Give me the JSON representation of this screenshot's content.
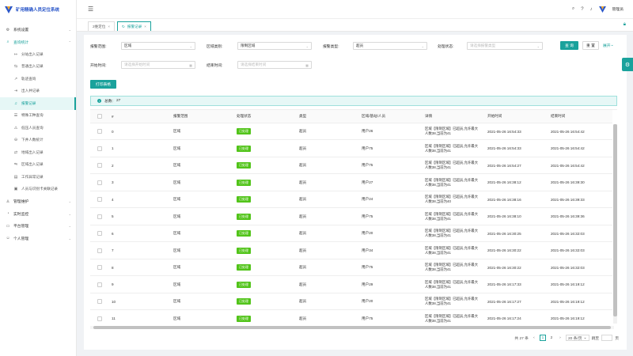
{
  "app": {
    "title": "矿用精确人员定位系统"
  },
  "colors": {
    "accent": "#1aa29c",
    "status_green": "#52c41a",
    "logo_blue": "#2b57c9"
  },
  "sidebar": {
    "items": [
      {
        "label": "系统设置",
        "icon": "gear-icon"
      },
      {
        "label": "查询统计",
        "icon": "search-icon"
      }
    ],
    "sub_items": [
      {
        "label": "分站出入记录",
        "icon": "exit-icon"
      },
      {
        "label": "普通出入记录",
        "icon": "link-icon"
      },
      {
        "label": "轨迹查询",
        "icon": "trend-icon"
      },
      {
        "label": "出入井记录",
        "icon": "enter-icon"
      },
      {
        "label": "报警记录",
        "icon": "bell-icon"
      },
      {
        "label": "特殊工种查询",
        "icon": "worker-icon"
      },
      {
        "label": "低压人员查询",
        "icon": "warning-icon"
      },
      {
        "label": "下井人数统计",
        "icon": "down-icon"
      },
      {
        "label": "地域出入记录",
        "icon": "map-icon"
      },
      {
        "label": "区域出入记录",
        "icon": "area-icon"
      },
      {
        "label": "工作异常记录",
        "icon": "doc-icon"
      },
      {
        "label": "人员与识别卡关联记录",
        "icon": "card-icon"
      }
    ],
    "bottom_items": [
      {
        "label": "管理维护",
        "icon": "user-icon"
      },
      {
        "label": "实时监控",
        "icon": "monitor-icon"
      },
      {
        "label": "平台管理",
        "icon": "desktop-icon"
      },
      {
        "label": "个人管理",
        "icon": "person-icon"
      }
    ]
  },
  "header": {
    "user_label": "管理员"
  },
  "tabs": [
    {
      "label": "2维定位"
    },
    {
      "label": "报警记录"
    }
  ],
  "filters": {
    "alarm_range_label": "报警范围:",
    "alarm_range_value": "区域",
    "area_category_label": "区域类别:",
    "area_category_value": "限制区域",
    "alarm_type_label": "报警类型:",
    "alarm_type_value": "超员",
    "status_label": "处理状态:",
    "status_placeholder": "请选择报警类型",
    "start_label": "开始时间:",
    "start_placeholder": "请选择开始时间",
    "end_label": "结束时间:",
    "end_placeholder": "请选择结束时间",
    "query_button": "查 询",
    "reset_button": "重 置",
    "expand_label": "展开"
  },
  "print_button": "打印表格",
  "summary": {
    "label": "总数:",
    "count": "27"
  },
  "table": {
    "headers": [
      "#",
      "报警范围",
      "处理状态",
      "类型",
      "区域/基站/人员",
      "详情",
      "开始时间",
      "结束时间"
    ],
    "rows": [
      {
        "idx": "0",
        "range": "区域",
        "status": "已处理",
        "type": "超员",
        "who": "用户26",
        "detail": "区域【限制区域】已超员,允许最大人数38,当前为41",
        "start": "2021-05-26 16:54:33",
        "end": "2021-05-26 16:54:42"
      },
      {
        "idx": "1",
        "range": "区域",
        "status": "已处理",
        "type": "超员",
        "who": "用户75",
        "detail": "区域【限制区域】已超员,允许最大人数38,当前为41",
        "start": "2021-05-26 16:54:33",
        "end": "2021-05-26 16:54:42"
      },
      {
        "idx": "2",
        "range": "区域",
        "status": "已处理",
        "type": "超员",
        "who": "用户75",
        "detail": "区域【限制区域】已超员,允许最大人数38,当前为41",
        "start": "2021-05-26 16:54:27",
        "end": "2021-05-26 16:54:42"
      },
      {
        "idx": "3",
        "range": "区域",
        "status": "已处理",
        "type": "超员",
        "who": "用户27",
        "detail": "区域【限制区域】已超员,允许最大人数38,当前为41",
        "start": "2021-05-26 16:38:12",
        "end": "2021-05-26 16:39:30"
      },
      {
        "idx": "4",
        "range": "区域",
        "status": "已处理",
        "type": "超员",
        "who": "用户24",
        "detail": "区域【限制区域】已超员,允许最大人数38,当前为40",
        "start": "2021-05-26 16:38:16",
        "end": "2021-05-26 16:39:33"
      },
      {
        "idx": "5",
        "range": "区域",
        "status": "已处理",
        "type": "超员",
        "who": "用户75",
        "detail": "区域【限制区域】已超员,允许最大人数38,当前为41",
        "start": "2021-05-26 16:38:10",
        "end": "2021-05-26 16:39:36"
      },
      {
        "idx": "6",
        "range": "区域",
        "status": "已处理",
        "type": "超员",
        "who": "用户20",
        "detail": "区域【限制区域】已超员,允许最大人数38,当前为41",
        "start": "2021-05-26 16:30:25",
        "end": "2021-05-26 16:32:03"
      },
      {
        "idx": "7",
        "range": "区域",
        "status": "已处理",
        "type": "超员",
        "who": "用户34",
        "detail": "区域【限制区域】已超员,允许最大人数38,当前为41",
        "start": "2021-05-26 16:30:22",
        "end": "2021-05-26 16:32:03"
      },
      {
        "idx": "8",
        "range": "区域",
        "status": "已处理",
        "type": "超员",
        "who": "用户75",
        "detail": "区域【限制区域】已超员,允许最大人数38,当前为41",
        "start": "2021-05-26 16:30:22",
        "end": "2021-05-26 16:32:03"
      },
      {
        "idx": "9",
        "range": "区域",
        "status": "已处理",
        "type": "超员",
        "who": "用户29",
        "detail": "区域【限制区域】已超员,允许最大人数38,当前为41",
        "start": "2021-05-26 16:17:33",
        "end": "2021-05-26 16:19:12"
      },
      {
        "idx": "10",
        "range": "区域",
        "status": "已处理",
        "type": "超员",
        "who": "用户20",
        "detail": "区域【限制区域】已超员,允许最大人数38,当前为41",
        "start": "2021-05-26 16:17:27",
        "end": "2021-05-26 16:19:12"
      },
      {
        "idx": "11",
        "range": "区域",
        "status": "已处理",
        "type": "超员",
        "who": "用户75",
        "detail": "区域【限制区域】已超员,允许最大人数38,当前为41",
        "start": "2021-05-26 16:17:24",
        "end": "2021-05-26 16:19:12"
      }
    ]
  },
  "pagination": {
    "total": "共 27 条",
    "pages": [
      "1",
      "2"
    ],
    "page_size": "20 条/页",
    "jump_label": "跳至",
    "page_suffix": "页"
  }
}
